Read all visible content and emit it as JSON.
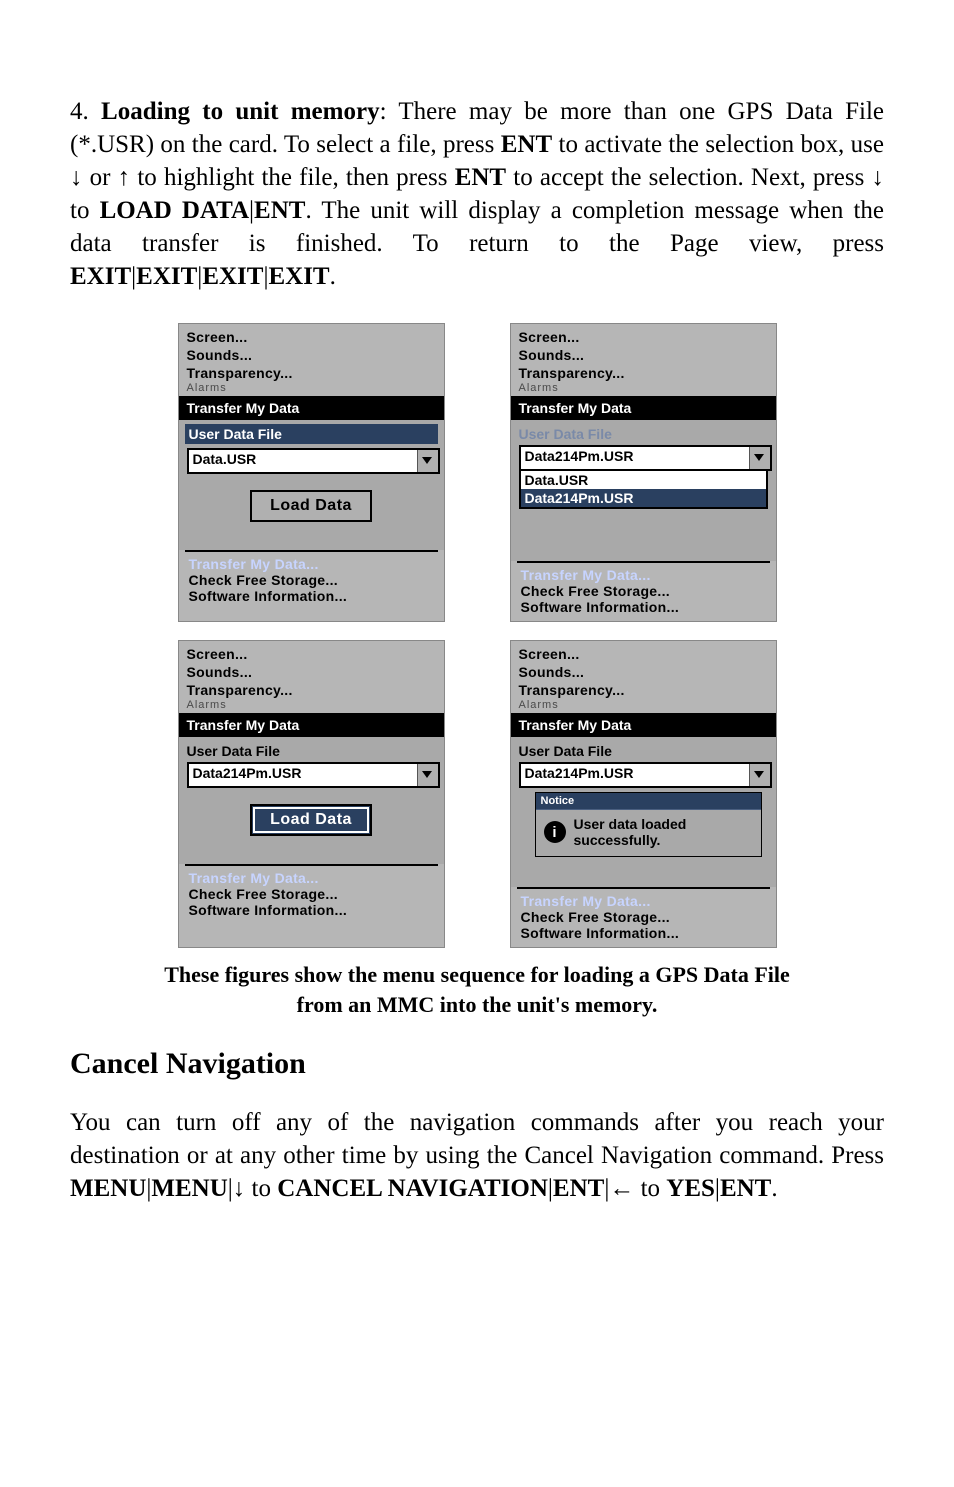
{
  "intro": {
    "num": "4. ",
    "heading": "Loading to unit memory",
    "p1a": ": There may be more than one GPS Data File (*.USR) on the card. To select a file, press ",
    "key_ent1": "ENT",
    "p1b": " to activate the selection box, use ↓ or ↑ to highlight the file, then press ",
    "key_ent2": "ENT",
    "p1c": " to accept the selection. Next, press ↓ to ",
    "cmd_load": "LOAD DATA",
    "sep1": "|",
    "key_ent3": "ENT",
    "p1d": ". The unit will display a completion message when the data transfer is finished. To return to the Page view, press ",
    "key_exit": "EXIT",
    "sep2": "|",
    "key_exit2": "EXIT",
    "sep3": "|",
    "key_exit3": "EXIT",
    "sep4": "|",
    "key_exit4": "EXIT",
    "period": "."
  },
  "device_menu": {
    "items": [
      "Screen...",
      "Sounds...",
      "Transparency..."
    ],
    "faded": "Alarms",
    "banner": "Transfer My Data",
    "label": "User Data File",
    "below": [
      "Transfer My Data...",
      "Check Free Storage...",
      "Software Information..."
    ]
  },
  "fig1": {
    "dropdown_value": "Data.USR",
    "load_label": "Load Data",
    "highlight_label": true
  },
  "fig2": {
    "dropdown_value": "Data214Pm.USR",
    "options": [
      "Data.USR",
      "Data214Pm.USR"
    ],
    "selected_option": "Data214Pm.USR"
  },
  "fig3": {
    "dropdown_value": "Data214Pm.USR",
    "load_label": "Load Data"
  },
  "fig4": {
    "dropdown_value": "Data214Pm.USR",
    "notice_title": "Notice",
    "notice_icon": "i",
    "notice_text1": "User data loaded",
    "notice_text2": "successfully."
  },
  "caption": {
    "line1": "These figures show the menu sequence for loading a GPS Data File",
    "line2": "from an MMC into the unit's memory."
  },
  "section_heading": "Cancel Navigation",
  "para2": {
    "a": "You can turn off any of the navigation commands after you reach your destination or at any other time by using the Cancel Navigation command. Press ",
    "menu": "MENU",
    "sep1": "|",
    "menu2": "MENU",
    "sep2": "|↓ to ",
    "cmd": "CANCEL NAVIGATION",
    "sep3": "|",
    "ent": "ENT",
    "sep4": "|← to ",
    "yes": "YES",
    "sep5": "|",
    "ent2": "ENT",
    "period": "."
  }
}
